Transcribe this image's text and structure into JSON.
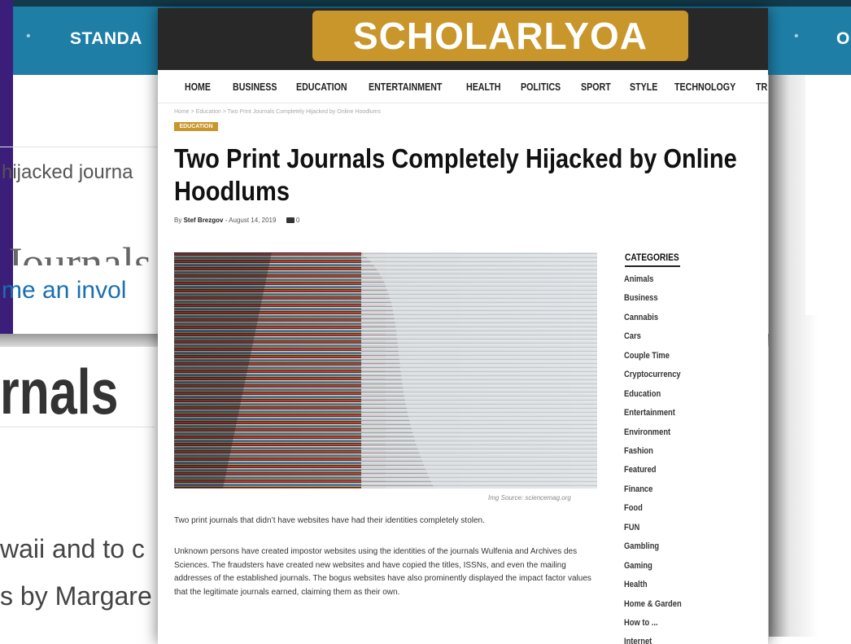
{
  "background": {
    "nav_left": "STANDA",
    "nav_right": "O",
    "dot": "•",
    "text_hijacked": "hijacked journa",
    "text_journals_partial": "Journals",
    "text_involved": "me an invol",
    "heading_partial": "rnals",
    "text_hawaii": "waii and to c",
    "text_margaret": "s by Margare"
  },
  "site": {
    "logo": "SCHOLARLYOA",
    "menu": [
      "HOME",
      "BUSINESS",
      "EDUCATION",
      "ENTERTAINMENT",
      "HEALTH",
      "POLITICS",
      "SPORT",
      "STYLE",
      "TECHNOLOGY",
      "TR"
    ]
  },
  "article": {
    "breadcrumb": "Home  >  Education  >  Two Print Journals Completely Hijacked by Online Hoodlums",
    "category_tag": "EDUCATION",
    "title_line1": "Two Print Journals Completely Hijacked by Online",
    "title_line2": "Hoodlums",
    "byline_prefix": "By",
    "author": "Stef Brezgov",
    "date": "- August 14, 2019",
    "comment_count": "0",
    "image_source": "Img Source: sciencemag.org",
    "paragraph1": "Two print journals that didn’t have websites have had their identities completely stolen.",
    "paragraph2": "Unknown persons have created impostor websites using the identities of the journals Wulfenia and Archives des Sciences. The fraudsters have created new websites and have copied the titles, ISSNs, and even the mailing addresses of the established journals. The bogus websites have also prominently displayed the impact factor values that the legitimate journals earned, claiming them as their own."
  },
  "sidebar": {
    "heading": "CATEGORIES",
    "categories": [
      "Animals",
      "Business",
      "Cannabis",
      "Cars",
      "Couple Time",
      "Cryptocurrency",
      "Education",
      "Entertainment",
      "Environment",
      "Fashion",
      "Featured",
      "Finance",
      "Food",
      "FUN",
      "Gambling",
      "Gaming",
      "Health",
      "Home & Garden",
      "How to ...",
      "Internet"
    ]
  }
}
